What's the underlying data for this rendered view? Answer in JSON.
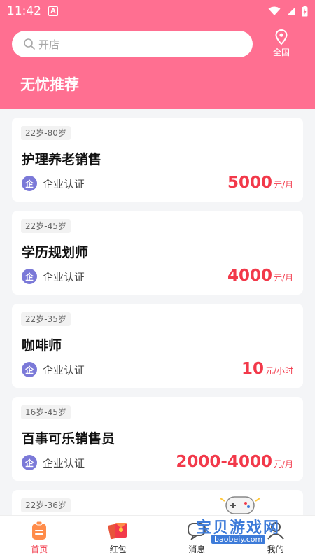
{
  "status_bar": {
    "time": "11:42",
    "notification_icon": "A"
  },
  "header": {
    "search_placeholder": "开店",
    "location_label": "全国",
    "section_title": "无忧推荐"
  },
  "jobs": [
    {
      "age_range": "22岁-80岁",
      "title": "护理养老销售",
      "cert_badge": "企",
      "cert_label": "企业认证",
      "salary": "5000",
      "salary_unit": "元/月"
    },
    {
      "age_range": "22岁-45岁",
      "title": "学历规划师",
      "cert_badge": "企",
      "cert_label": "企业认证",
      "salary": "4000",
      "salary_unit": "元/月"
    },
    {
      "age_range": "22岁-35岁",
      "title": "咖啡师",
      "cert_badge": "企",
      "cert_label": "企业认证",
      "salary": "10",
      "salary_unit": "元/小时"
    },
    {
      "age_range": "16岁-45岁",
      "title": "百事可乐销售员",
      "cert_badge": "企",
      "cert_label": "企业认证",
      "salary": "2000-4000",
      "salary_unit": "元/月"
    },
    {
      "age_range": "22岁-36岁"
    }
  ],
  "tabbar": {
    "items": [
      {
        "label": "首页",
        "icon": "home-icon",
        "active": true
      },
      {
        "label": "红包",
        "icon": "red-packet-icon",
        "active": false
      },
      {
        "label": "消息",
        "icon": "message-icon",
        "active": false
      },
      {
        "label": "我的",
        "icon": "profile-icon",
        "active": false
      }
    ]
  },
  "watermark": {
    "text": "宝贝游戏网",
    "url": "baobeiy.com"
  },
  "colors": {
    "brand": "#ff6f91",
    "salary": "#f2394a",
    "cert_badge": "#7b79d8"
  }
}
